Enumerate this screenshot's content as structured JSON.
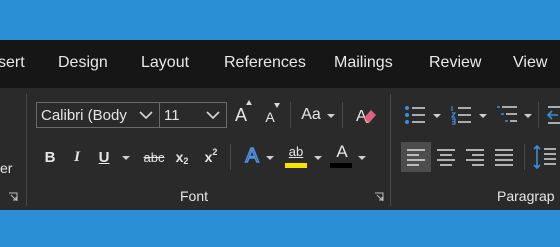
{
  "tabs": [
    "sert",
    "Design",
    "Layout",
    "References",
    "Mailings",
    "Review",
    "View"
  ],
  "left_group_fragment": "er",
  "font": {
    "group_label": "Font",
    "font_name": "Calibri (Body",
    "font_size": "11",
    "grow_glyph": "A",
    "shrink_glyph": "A",
    "change_case_glyph": "Aa",
    "bold_glyph": "B",
    "italic_glyph": "I",
    "underline_glyph": "U",
    "strike_glyph": "abc",
    "subscript_glyph": "x",
    "subscript_small": "2",
    "superscript_glyph": "x",
    "superscript_small": "2",
    "text_effects_glyph": "A",
    "highlight_glyph": "ab",
    "font_color_glyph": "A"
  },
  "paragraph": {
    "group_label": "Paragrap"
  },
  "colors": {
    "highlight": "#f4e400",
    "font_color": "#000000",
    "effects": "#3a7bd5",
    "eraser": "#e0607a",
    "accent_blue": "#3a8fd8"
  },
  "icons": [
    "font-grow-icon",
    "font-shrink-icon",
    "change-case-icon",
    "clear-formatting-icon",
    "bullets-icon",
    "numbering-icon",
    "multilevel-list-icon",
    "decrease-indent-icon",
    "align-left-icon",
    "align-center-icon",
    "align-right-icon",
    "justify-icon",
    "line-spacing-icon",
    "dialog-launcher-icon"
  ]
}
